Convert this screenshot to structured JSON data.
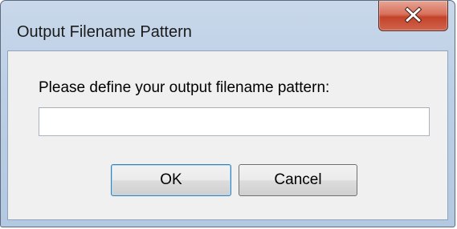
{
  "window": {
    "title": "Output Filename Pattern",
    "close_icon": "close-x-icon"
  },
  "dialog": {
    "prompt": "Please define your output filename pattern:",
    "input_value": "",
    "input_placeholder": "",
    "ok_label": "OK",
    "cancel_label": "Cancel"
  },
  "colors": {
    "frame": "#bccfe6",
    "client": "#f0f0f0",
    "close_button": "#c4432a",
    "default_button_border": "#3c7fb1"
  }
}
